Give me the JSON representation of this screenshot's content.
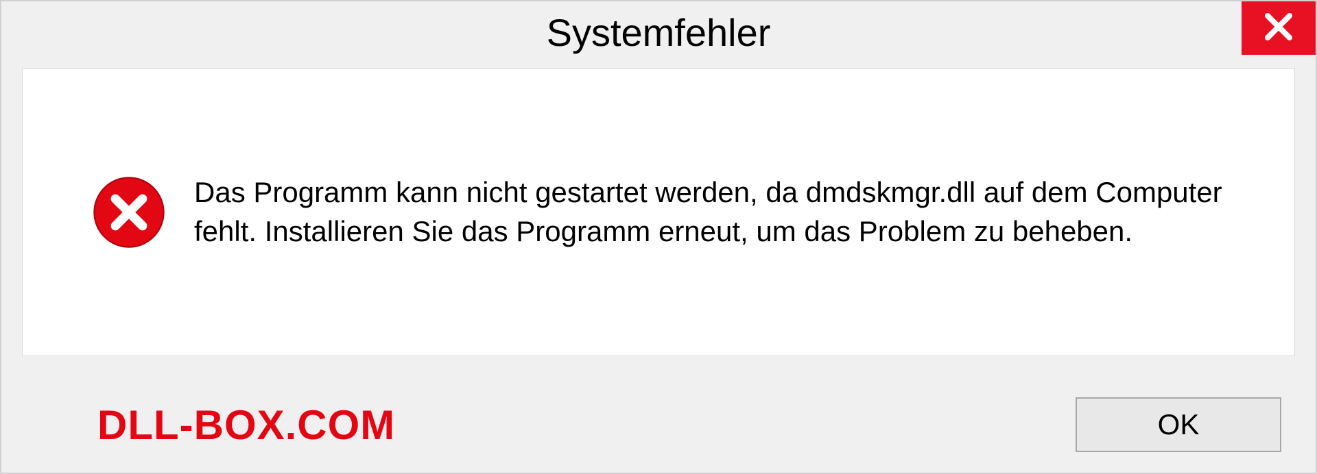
{
  "dialog": {
    "title": "Systemfehler",
    "message": "Das Programm kann nicht gestartet werden, da dmdskmgr.dll auf dem Computer fehlt. Installieren Sie das Programm erneut, um das Problem zu beheben.",
    "ok_label": "OK"
  },
  "watermark": "DLL-BOX.COM"
}
